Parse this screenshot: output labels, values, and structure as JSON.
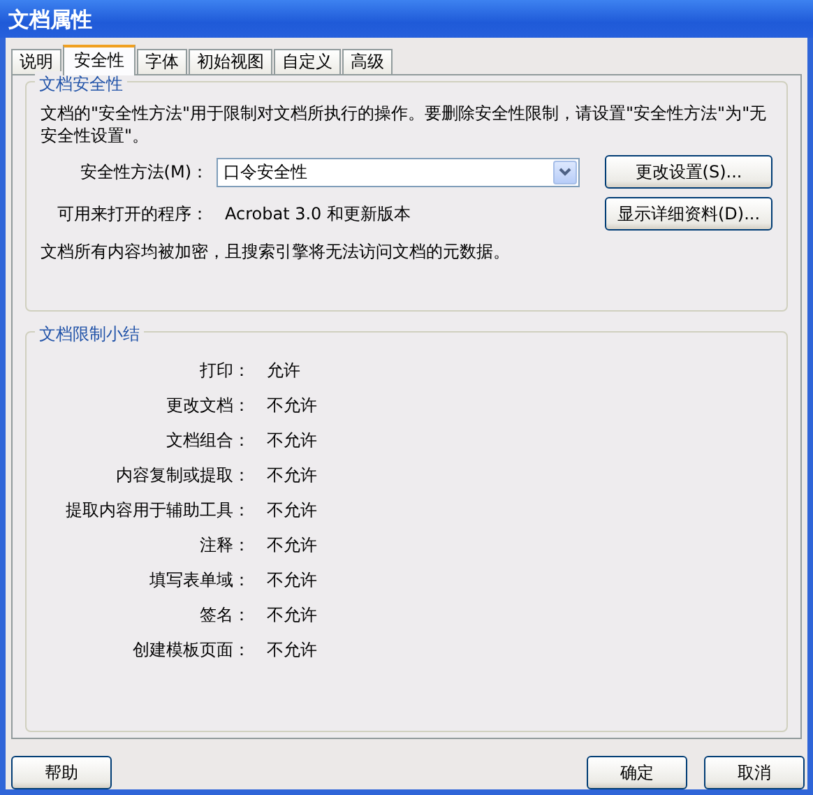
{
  "window": {
    "title": "文档属性"
  },
  "tabs": [
    {
      "label": "说明",
      "selected": false
    },
    {
      "label": "安全性",
      "selected": true
    },
    {
      "label": "字体",
      "selected": false
    },
    {
      "label": "初始视图",
      "selected": false
    },
    {
      "label": "自定义",
      "selected": false
    },
    {
      "label": "高级",
      "selected": false
    }
  ],
  "security": {
    "title": "文档安全性",
    "description": "文档的\"安全性方法\"用于限制对文档所执行的操作。要删除安全性限制，请设置\"安全性方法\"为\"无安全性设置\"。",
    "method_label": "安全性方法(M)：",
    "method_value": "口令安全性",
    "change_button": "更改设置(S)...",
    "open_with_label": "可用来打开的程序：",
    "open_with_value": "Acrobat 3.0 和更新版本",
    "details_button": "显示详细资料(D)...",
    "note": "文档所有内容均被加密，且搜索引擎将无法访问文档的元数据。"
  },
  "restrictions": {
    "title": "文档限制小结",
    "rows": [
      {
        "label": "打印：",
        "value": "允许"
      },
      {
        "label": "更改文档：",
        "value": "不允许"
      },
      {
        "label": "文档组合：",
        "value": "不允许"
      },
      {
        "label": "内容复制或提取：",
        "value": "不允许"
      },
      {
        "label": "提取内容用于辅助工具：",
        "value": "不允许"
      },
      {
        "label": "注释：",
        "value": "不允许"
      },
      {
        "label": "填写表单域：",
        "value": "不允许"
      },
      {
        "label": "签名：",
        "value": "不允许"
      },
      {
        "label": "创建模板页面：",
        "value": "不允许"
      }
    ]
  },
  "buttons": {
    "help": "帮助",
    "ok": "确定",
    "cancel": "取消"
  }
}
